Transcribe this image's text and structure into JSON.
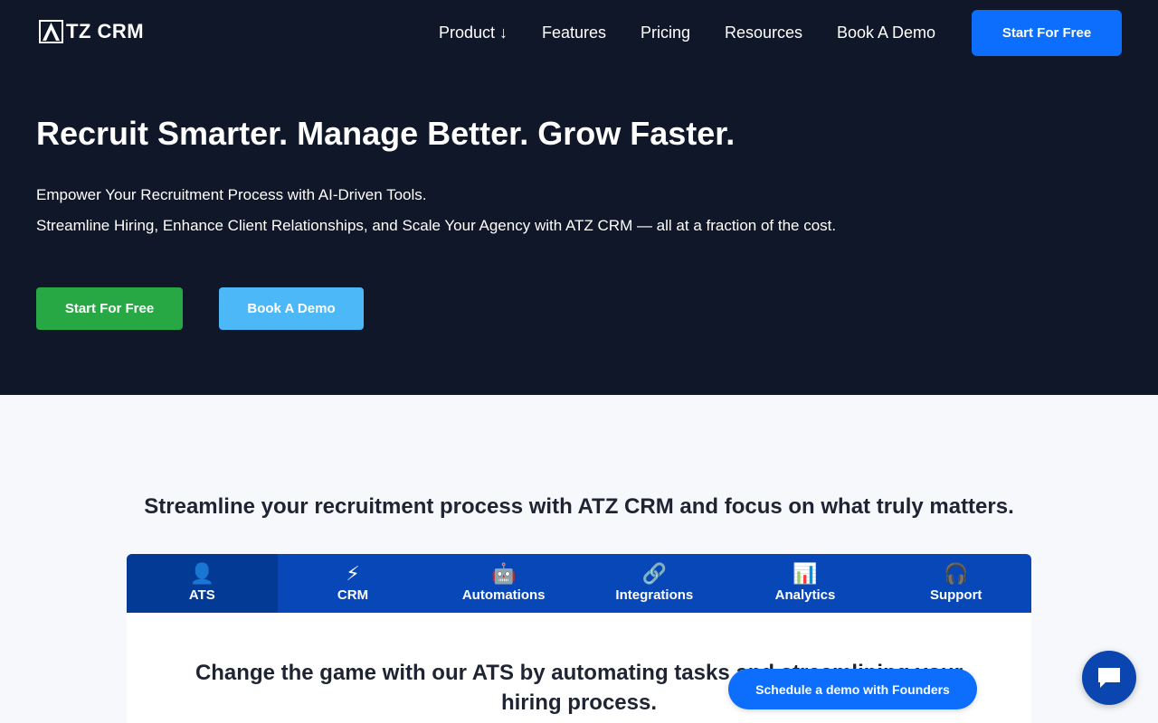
{
  "brand": {
    "name": "TZ CRM",
    "mark": "A"
  },
  "nav": {
    "items": [
      {
        "label": "Product ↓"
      },
      {
        "label": "Features"
      },
      {
        "label": "Pricing"
      },
      {
        "label": "Resources"
      },
      {
        "label": "Book A Demo"
      }
    ],
    "cta_label": "Start For Free"
  },
  "hero": {
    "title": "Recruit Smarter. Manage Better. Grow Faster.",
    "subtitle_1": "Empower Your Recruitment Process with AI-Driven Tools.",
    "subtitle_2": "Streamline Hiring, Enhance Client Relationships, and Scale Your Agency with ATZ CRM — all at a fraction of the cost.",
    "primary_cta": "Start For Free",
    "secondary_cta": "Book A Demo"
  },
  "features": {
    "heading": "Streamline your recruitment process with ATZ CRM and focus on what truly matters.",
    "tabs": [
      {
        "icon": "👤",
        "icon_name": "user-icon",
        "label": "ATS"
      },
      {
        "icon": "⚡",
        "icon_name": "lightning-icon",
        "label": "CRM"
      },
      {
        "icon": "🤖",
        "icon_name": "robot-icon",
        "label": "Automations"
      },
      {
        "icon": "🔗",
        "icon_name": "link-icon",
        "label": "Integrations"
      },
      {
        "icon": "📊",
        "icon_name": "bar-chart-icon",
        "label": "Analytics"
      },
      {
        "icon": "🎧",
        "icon_name": "headphones-icon",
        "label": "Support"
      }
    ],
    "active_tab": "ATS",
    "panel_title": "Change the game with our ATS by automating tasks and streamlining your hiring process."
  },
  "widgets": {
    "schedule_label": "Schedule a demo with Founders",
    "chat_icon": "chat-bubble-icon"
  },
  "colors": {
    "hero_bg": "#101729",
    "primary_blue": "#0d6efd",
    "green": "#28a745",
    "light_blue": "#4db8f7",
    "tab_bg": "#0747b8",
    "tab_active": "#033a96"
  }
}
